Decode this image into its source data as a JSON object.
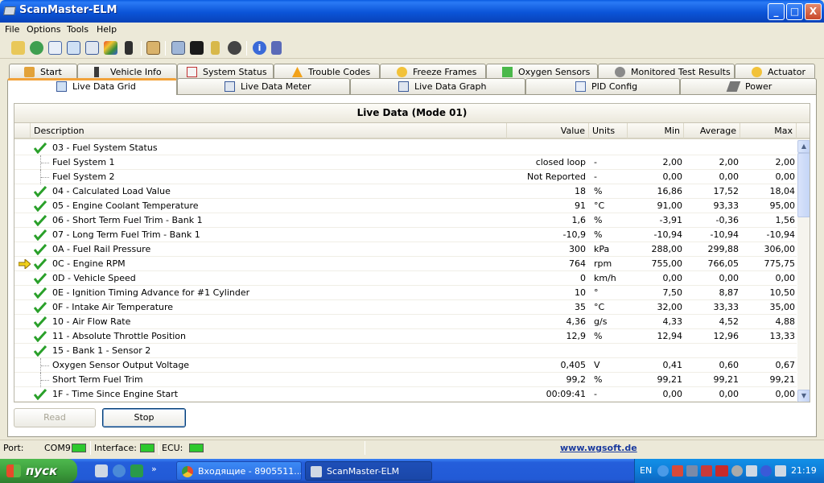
{
  "window": {
    "title": "ScanMaster-ELM",
    "minimize": "_",
    "maximize": "□",
    "close": "X"
  },
  "menu": [
    "File",
    "Options",
    "Tools",
    "Help"
  ],
  "toolbar_icons": [
    "wrench-icon",
    "globe-icon",
    "document-icon",
    "grid-icon",
    "meter-icon",
    "graph-icon",
    "traffic-light-icon",
    "clipboard-icon",
    "monitor-icon",
    "terminal-icon",
    "battery-icon",
    "gauge-icon",
    "info-icon",
    "book-icon"
  ],
  "tabs_top": [
    "Start",
    "Vehicle Info",
    "System Status",
    "Trouble Codes",
    "Freeze Frames",
    "Oxygen Sensors",
    "Monitored Test Results",
    "Actuator"
  ],
  "tabs_bottom": [
    "Live Data Grid",
    "Live Data Meter",
    "Live Data Graph",
    "PID Config",
    "Power"
  ],
  "grid": {
    "title": "Live Data (Mode 01)",
    "columns": {
      "description": "Description",
      "value": "Value",
      "units": "Units",
      "min": "Min",
      "average": "Average",
      "max": "Max"
    },
    "rows": [
      {
        "desc": "03 - Fuel System Status",
        "value": "",
        "units": "",
        "min": "",
        "avg": "",
        "max": "",
        "check": true,
        "child": false,
        "arrow": false
      },
      {
        "desc": "Fuel System 1",
        "value": "closed loop",
        "units": "-",
        "min": "2,00",
        "avg": "2,00",
        "max": "2,00",
        "check": false,
        "child": true,
        "arrow": false
      },
      {
        "desc": "Fuel System 2",
        "value": "Not Reported",
        "units": "-",
        "min": "0,00",
        "avg": "0,00",
        "max": "0,00",
        "check": false,
        "child": true,
        "arrow": false
      },
      {
        "desc": "04 - Calculated Load Value",
        "value": "18",
        "units": "%",
        "min": "16,86",
        "avg": "17,52",
        "max": "18,04",
        "check": true,
        "child": false,
        "arrow": false
      },
      {
        "desc": "05 - Engine Coolant Temperature",
        "value": "91",
        "units": "°C",
        "min": "91,00",
        "avg": "93,33",
        "max": "95,00",
        "check": true,
        "child": false,
        "arrow": false
      },
      {
        "desc": "06 - Short Term Fuel Trim - Bank 1",
        "value": "1,6",
        "units": "%",
        "min": "-3,91",
        "avg": "-0,36",
        "max": "1,56",
        "check": true,
        "child": false,
        "arrow": false
      },
      {
        "desc": "07 - Long Term Fuel Trim - Bank 1",
        "value": "-10,9",
        "units": "%",
        "min": "-10,94",
        "avg": "-10,94",
        "max": "-10,94",
        "check": true,
        "child": false,
        "arrow": false
      },
      {
        "desc": "0A - Fuel Rail Pressure",
        "value": "300",
        "units": "kPa",
        "min": "288,00",
        "avg": "299,88",
        "max": "306,00",
        "check": true,
        "child": false,
        "arrow": false
      },
      {
        "desc": "0C - Engine RPM",
        "value": "764",
        "units": "rpm",
        "min": "755,00",
        "avg": "766,05",
        "max": "775,75",
        "check": true,
        "child": false,
        "arrow": true
      },
      {
        "desc": "0D - Vehicle Speed",
        "value": "0",
        "units": "km/h",
        "min": "0,00",
        "avg": "0,00",
        "max": "0,00",
        "check": true,
        "child": false,
        "arrow": false
      },
      {
        "desc": "0E - Ignition Timing Advance for #1 Cylinder",
        "value": "10",
        "units": "°",
        "min": "7,50",
        "avg": "8,87",
        "max": "10,50",
        "check": true,
        "child": false,
        "arrow": false
      },
      {
        "desc": "0F - Intake Air Temperature",
        "value": "35",
        "units": "°C",
        "min": "32,00",
        "avg": "33,33",
        "max": "35,00",
        "check": true,
        "child": false,
        "arrow": false
      },
      {
        "desc": "10 - Air Flow Rate",
        "value": "4,36",
        "units": "g/s",
        "min": "4,33",
        "avg": "4,52",
        "max": "4,88",
        "check": true,
        "child": false,
        "arrow": false
      },
      {
        "desc": "11 - Absolute Throttle Position",
        "value": "12,9",
        "units": "%",
        "min": "12,94",
        "avg": "12,96",
        "max": "13,33",
        "check": true,
        "child": false,
        "arrow": false
      },
      {
        "desc": "15 - Bank 1 - Sensor 2",
        "value": "",
        "units": "",
        "min": "",
        "avg": "",
        "max": "",
        "check": true,
        "child": false,
        "arrow": false
      },
      {
        "desc": "Oxygen Sensor Output Voltage",
        "value": "0,405",
        "units": "V",
        "min": "0,41",
        "avg": "0,60",
        "max": "0,67",
        "check": false,
        "child": true,
        "arrow": false
      },
      {
        "desc": "Short Term Fuel Trim",
        "value": "99,2",
        "units": "%",
        "min": "99,21",
        "avg": "99,21",
        "max": "99,21",
        "check": false,
        "child": true,
        "arrow": false
      },
      {
        "desc": "1F - Time Since Engine Start",
        "value": "00:09:41",
        "units": "-",
        "min": "0,00",
        "avg": "0,00",
        "max": "0,00",
        "check": true,
        "child": false,
        "arrow": false
      }
    ]
  },
  "buttons": {
    "read": "Read",
    "stop": "Stop"
  },
  "status": {
    "port_label": "Port:",
    "port_value": "COM9",
    "interface_label": "Interface:",
    "ecu_label": "ECU:",
    "website": "www.wgsoft.de",
    "led_color": "#2dc92d"
  },
  "taskbar": {
    "start": "пуск",
    "tasks": [
      "Входящие - 8905511...",
      "ScanMaster-ELM"
    ],
    "lang": "EN",
    "clock": "21:19"
  }
}
